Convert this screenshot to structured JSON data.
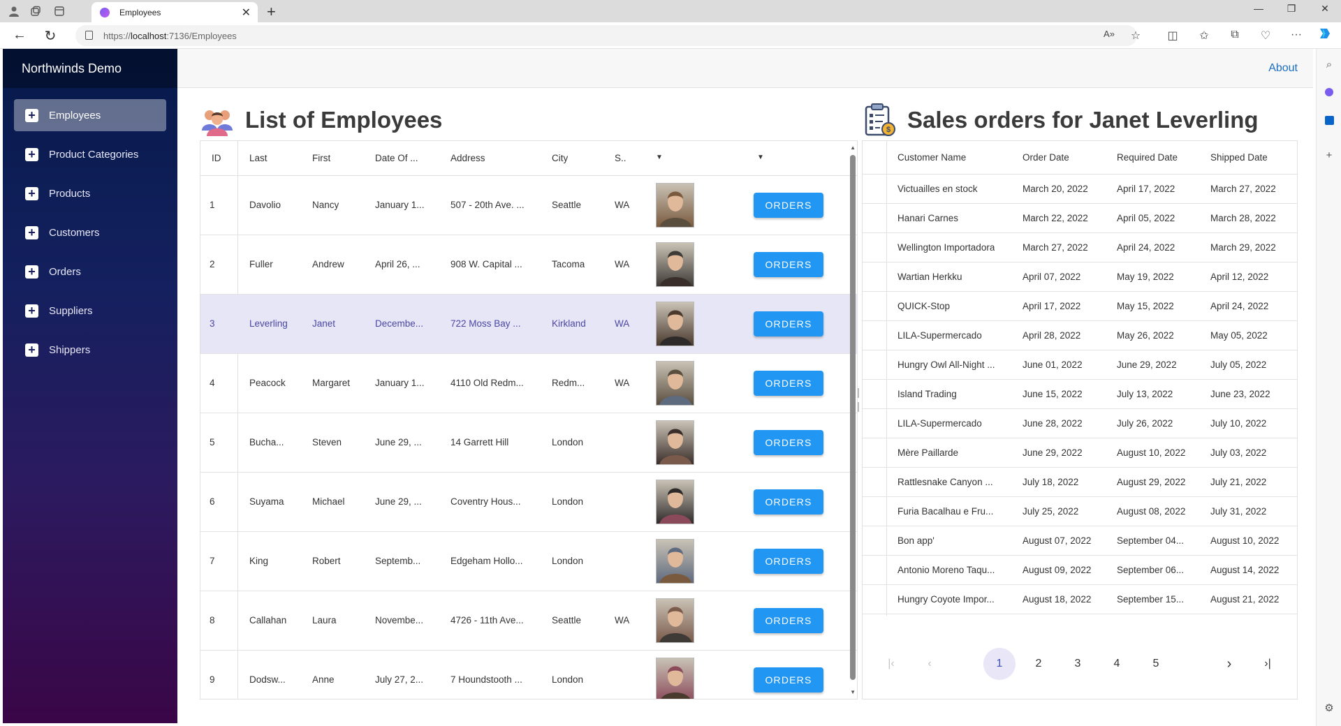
{
  "browser": {
    "tab_title": "Employees",
    "url_scheme": "https://",
    "url_host": "localhost",
    "url_path": ":7136/Employees"
  },
  "app": {
    "brand": "Northwinds Demo",
    "about": "About",
    "nav": [
      {
        "label": "Employees",
        "active": true
      },
      {
        "label": "Product Categories"
      },
      {
        "label": "Products"
      },
      {
        "label": "Customers"
      },
      {
        "label": "Orders"
      },
      {
        "label": "Suppliers"
      },
      {
        "label": "Shippers"
      }
    ]
  },
  "employees": {
    "title": "List of Employees",
    "columns": [
      "ID",
      "Last",
      "First",
      "Date Of ...",
      "Address",
      "City",
      "S.."
    ],
    "order_button": "ORDERS",
    "rows": [
      {
        "id": "1",
        "last": "Davolio",
        "first": "Nancy",
        "date": "January 1...",
        "address": "507 - 20th Ave. ...",
        "city": "Seattle",
        "state": "WA"
      },
      {
        "id": "2",
        "last": "Fuller",
        "first": "Andrew",
        "date": "April 26, ...",
        "address": "908 W. Capital ...",
        "city": "Tacoma",
        "state": "WA"
      },
      {
        "id": "3",
        "last": "Leverling",
        "first": "Janet",
        "date": "Decembe...",
        "address": "722 Moss Bay ...",
        "city": "Kirkland",
        "state": "WA",
        "selected": true
      },
      {
        "id": "4",
        "last": "Peacock",
        "first": "Margaret",
        "date": "January 1...",
        "address": "4110 Old Redm...",
        "city": "Redm...",
        "state": "WA"
      },
      {
        "id": "5",
        "last": "Bucha...",
        "first": "Steven",
        "date": "June 29, ...",
        "address": "14 Garrett Hill",
        "city": "London",
        "state": ""
      },
      {
        "id": "6",
        "last": "Suyama",
        "first": "Michael",
        "date": "June 29, ...",
        "address": "Coventry Hous...",
        "city": "London",
        "state": ""
      },
      {
        "id": "7",
        "last": "King",
        "first": "Robert",
        "date": "Septemb...",
        "address": "Edgeham Hollo...",
        "city": "London",
        "state": ""
      },
      {
        "id": "8",
        "last": "Callahan",
        "first": "Laura",
        "date": "Novembe...",
        "address": "4726 - 11th Ave...",
        "city": "Seattle",
        "state": "WA"
      },
      {
        "id": "9",
        "last": "Dodsw...",
        "first": "Anne",
        "date": "July 27, 2...",
        "address": "7 Houndstooth ...",
        "city": "London",
        "state": ""
      }
    ]
  },
  "orders": {
    "title": "Sales orders for Janet Leverling",
    "columns": [
      "Customer Name",
      "Order Date",
      "Required Date",
      "Shipped Date"
    ],
    "rows": [
      {
        "customer": "Victuailles en stock",
        "order": "March 20, 2022",
        "required": "April 17, 2022",
        "shipped": "March 27, 2022"
      },
      {
        "customer": "Hanari Carnes",
        "order": "March 22, 2022",
        "required": "April 05, 2022",
        "shipped": "March 28, 2022"
      },
      {
        "customer": "Wellington Importadora",
        "order": "March 27, 2022",
        "required": "April 24, 2022",
        "shipped": "March 29, 2022"
      },
      {
        "customer": "Wartian Herkku",
        "order": "April 07, 2022",
        "required": "May 19, 2022",
        "shipped": "April 12, 2022"
      },
      {
        "customer": "QUICK-Stop",
        "order": "April 17, 2022",
        "required": "May 15, 2022",
        "shipped": "April 24, 2022"
      },
      {
        "customer": "LILA-Supermercado",
        "order": "April 28, 2022",
        "required": "May 26, 2022",
        "shipped": "May 05, 2022"
      },
      {
        "customer": "Hungry Owl All-Night ...",
        "order": "June 01, 2022",
        "required": "June 29, 2022",
        "shipped": "July 05, 2022"
      },
      {
        "customer": "Island Trading",
        "order": "June 15, 2022",
        "required": "July 13, 2022",
        "shipped": "June 23, 2022"
      },
      {
        "customer": "LILA-Supermercado",
        "order": "June 28, 2022",
        "required": "July 26, 2022",
        "shipped": "July 10, 2022"
      },
      {
        "customer": "Mère Paillarde",
        "order": "June 29, 2022",
        "required": "August 10, 2022",
        "shipped": "July 03, 2022"
      },
      {
        "customer": "Rattlesnake Canyon ...",
        "order": "July 18, 2022",
        "required": "August 29, 2022",
        "shipped": "July 21, 2022"
      },
      {
        "customer": "Furia Bacalhau e Fru...",
        "order": "July 25, 2022",
        "required": "August 08, 2022",
        "shipped": "July 31, 2022"
      },
      {
        "customer": "Bon app'",
        "order": "August 07, 2022",
        "required": "September 04...",
        "shipped": "August 10, 2022"
      },
      {
        "customer": "Antonio Moreno Taqu...",
        "order": "August 09, 2022",
        "required": "September 06...",
        "shipped": "August 14, 2022"
      },
      {
        "customer": "Hungry Coyote Impor...",
        "order": "August 18, 2022",
        "required": "September 15...",
        "shipped": "August 21, 2022"
      }
    ],
    "pager": {
      "pages": [
        "1",
        "2",
        "3",
        "4",
        "5"
      ],
      "current": "1"
    }
  },
  "colors": {
    "accent": "#2196f3",
    "selected_row": "#e7e6f7",
    "link": "#1b6ec2"
  }
}
